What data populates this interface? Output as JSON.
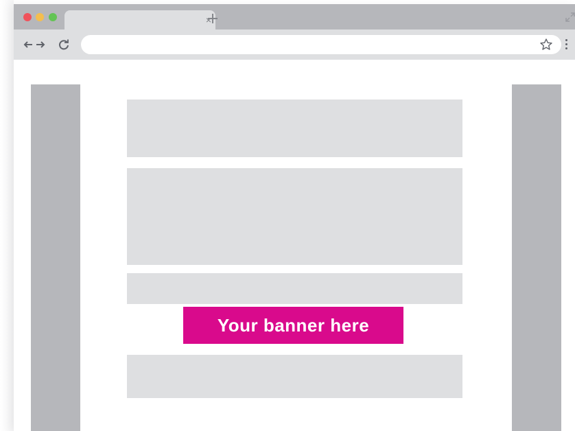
{
  "browser": {
    "tab": {
      "close_glyph": "×"
    },
    "icons": {
      "back": "arrow-left-icon",
      "forward": "arrow-right-icon",
      "reload": "reload-icon",
      "star": "star-icon",
      "menu": "kebab-menu-icon",
      "new_tab": "plus-icon",
      "resize": "expand-icon"
    },
    "address_bar": {
      "value": ""
    }
  },
  "page": {
    "banner": {
      "label": "Your banner here",
      "color": "#d90a8c"
    }
  },
  "colors": {
    "tabbar": "#b6b7bb",
    "toolbar": "#dedfe1",
    "placeholder_block": "#dedfe1",
    "sidebar": "#b6b7bb",
    "traffic_red": "#f0525b",
    "traffic_yellow": "#f4be4f",
    "traffic_green": "#63c454"
  }
}
